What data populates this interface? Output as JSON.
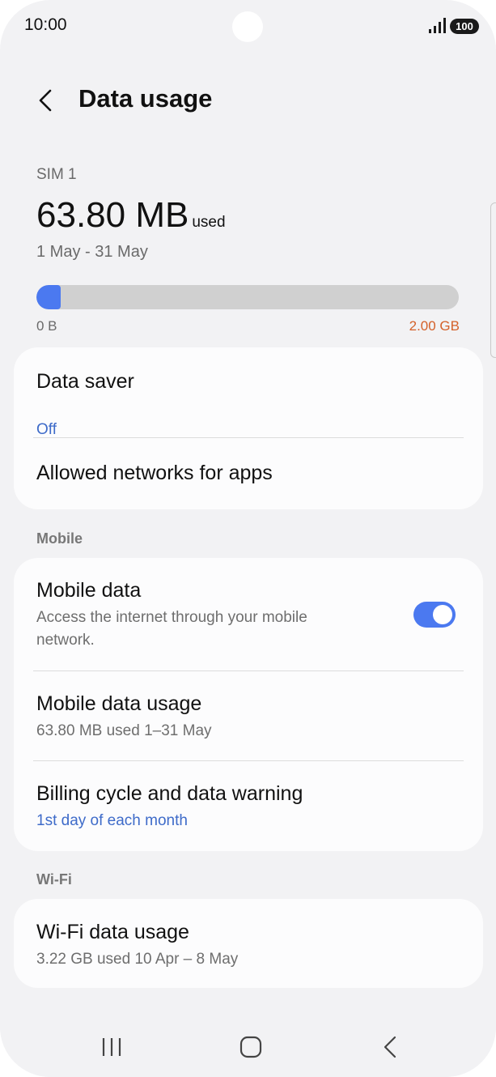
{
  "status_bar": {
    "time": "10:00",
    "battery": "100",
    "signal_icon": "signal-bars-icon"
  },
  "header": {
    "title": "Data usage",
    "back_icon": "chevron-left-icon"
  },
  "summary": {
    "sim_label": "SIM 1",
    "used_amount": "63.80 MB",
    "used_suffix": "used",
    "period": "1 May - 31 May",
    "progress_fraction": 0.031,
    "range_min": "0 B",
    "range_max": "2.00 GB"
  },
  "card_general": {
    "data_saver": {
      "title": "Data saver",
      "value": "Off"
    },
    "allowed_networks": {
      "title": "Allowed networks for apps"
    }
  },
  "section_mobile": {
    "label": "Mobile",
    "mobile_data": {
      "title": "Mobile data",
      "description": "Access the internet through your mobile network.",
      "enabled": true
    },
    "mobile_data_usage": {
      "title": "Mobile data usage",
      "subtitle": "63.80 MB used 1–31 May"
    },
    "billing_cycle": {
      "title": "Billing cycle and data warning",
      "subtitle": "1st day of each month"
    }
  },
  "section_wifi": {
    "label": "Wi-Fi",
    "wifi_data_usage": {
      "title": "Wi-Fi data usage",
      "subtitle": "3.22 GB used 10 Apr – 8 May"
    }
  },
  "navbar": {
    "recents_icon": "recents-icon",
    "home_icon": "home-icon",
    "back_icon": "back-icon"
  },
  "colors": {
    "accent": "#4b79f0",
    "link": "#3e6bc9",
    "limit": "#d4612a",
    "background": "#f2f2f4",
    "card": "#fcfcfd"
  }
}
